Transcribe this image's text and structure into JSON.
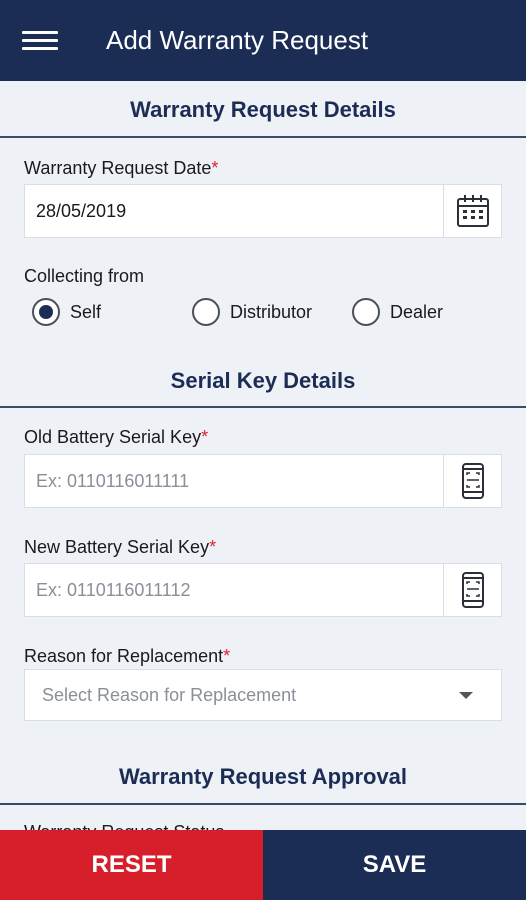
{
  "header": {
    "title": "Add Warranty Request"
  },
  "sections": {
    "details_title": "Warranty Request Details",
    "serial_title": "Serial Key Details",
    "approval_title": "Warranty Request Approval"
  },
  "warranty_date": {
    "label": "Warranty Request Date",
    "required_mark": "*",
    "value": "28/05/2019"
  },
  "collecting_from": {
    "label": "Collecting from",
    "options": [
      "Self",
      "Distributor",
      "Dealer"
    ],
    "selected": "Self"
  },
  "old_serial": {
    "label": "Old Battery Serial Key",
    "required_mark": "*",
    "placeholder": "Ex: 0110116011111"
  },
  "new_serial": {
    "label": "New Battery Serial Key",
    "required_mark": "*",
    "placeholder": "Ex: 0110116011112"
  },
  "reason": {
    "label": "Reason for Replacement",
    "required_mark": "*",
    "placeholder": "Select Reason for Replacement"
  },
  "approval": {
    "status_label": "Warranty Request Status"
  },
  "footer": {
    "reset_label": "RESET",
    "save_label": "SAVE"
  },
  "colors": {
    "primary": "#1b2c55",
    "danger": "#d71f2c",
    "background": "#eef1f6"
  }
}
